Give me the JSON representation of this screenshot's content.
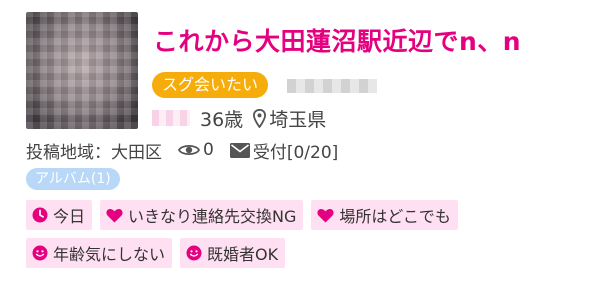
{
  "profile": {
    "title": "これから大田蓮沼駅近辺でn、n",
    "badge": "スグ会いたい",
    "age": "36歳",
    "location": "埼玉県"
  },
  "info": {
    "area_label": "投稿地域：大田区",
    "view_count": "0",
    "received": "受付[0/20]"
  },
  "album_label": "アルバム(1)",
  "tags_row1": [
    "今日",
    "いきなり連絡先交換NG",
    "場所はどこでも"
  ],
  "tags_row2": [
    "年齢気にしない",
    "既婚者OK"
  ],
  "colors": {
    "accent": "#e5007f",
    "badge": "#f6ad0b",
    "album": "#b9d8f7",
    "tag_bg": "#ffe0f2"
  },
  "icons": {
    "location": "map-pin-icon",
    "views": "eye-icon",
    "received": "envelope-icon",
    "tag_today": "clock-icon",
    "tag_heart": "heart-icon",
    "tag_smile": "smile-icon"
  }
}
